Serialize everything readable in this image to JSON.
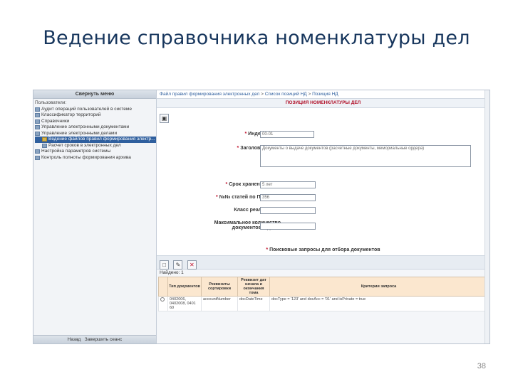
{
  "slide": {
    "title": "Ведение справочника номенклатуры дел",
    "page_number": "38"
  },
  "sidebar": {
    "collapse_label": "Свернуть меню",
    "root_label": "Пользователи:",
    "items": [
      {
        "label": "Аудит операций пользователей в системе",
        "level": 1
      },
      {
        "label": "Классификатор территорий",
        "level": 1
      },
      {
        "label": "Справочники",
        "level": 1
      },
      {
        "label": "Управление электронными документами",
        "level": 1
      },
      {
        "label": "Управление электронными делами",
        "level": 1
      },
      {
        "label": "Ведение файлов правил формирования электр...",
        "level": 2,
        "selected": true
      },
      {
        "label": "Расчет сроков в электронных дел",
        "level": 2
      },
      {
        "label": "Настройка параметров системы",
        "level": 1
      },
      {
        "label": "Контроль полноты формирования архива",
        "level": 1
      }
    ],
    "footer_back": "Назад",
    "footer_logout": "Завершить сеанс"
  },
  "main": {
    "breadcrumb": [
      "Файл правил формирования электронных дел",
      "Список позиций НД",
      "Позиция НД"
    ],
    "form_title": "ПОЗИЦИЯ НОМЕНКЛАТУРЫ ДЕЛ",
    "fields": {
      "index_label": "Индекс дела:",
      "index_value": "00-01",
      "title_label": "Заголовок дела:",
      "title_value": "Документы о выдаче документов (расчетные документы, мемориальные ордера)",
      "storage_label": "Срок хранения дела:",
      "storage_value": "5 лет",
      "article_label": "№№ статей по Перечню:",
      "article_value": "356",
      "class_label": "Класс реализации:",
      "max_docs_label": "Максимальное количество документов в деле:"
    },
    "search_line": "Поисковые запросы для отбора документов",
    "found_label": "Найдено: 1",
    "grid": {
      "headers": [
        "Тип документов",
        "Реквизиты сортировки",
        "Реквизит дат начала и окончания тома",
        "Критерии запроса"
      ],
      "rows": [
        {
          "types": "0402006, 0402008, 0401 60",
          "sort": "accountNumber",
          "date_attr": "docDateTime",
          "criteria": "docType = '123' and docAcc = '01' and isPrivate = true"
        }
      ]
    }
  },
  "colors": {
    "title": "#17365d",
    "selected_nav": "#2f5f9e",
    "required": "#c0102a",
    "grid_header": "#fbe7cf"
  },
  "icons": {
    "save": "save-icon",
    "new": "new-document-icon",
    "edit": "edit-icon",
    "delete": "delete-icon",
    "nav_item": "folder-icon"
  }
}
